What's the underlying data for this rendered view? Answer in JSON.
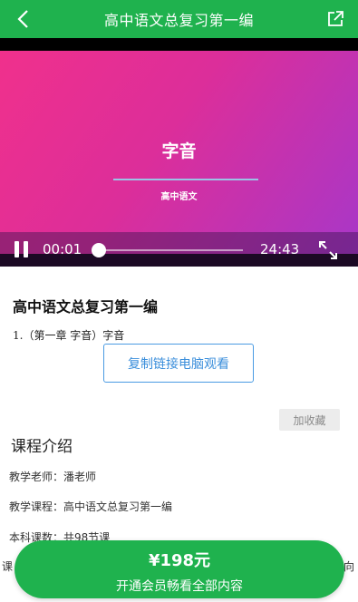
{
  "header": {
    "title": "高中语文总复习第一编",
    "back_icon": "chevron-left-icon",
    "share_icon": "share-external-icon",
    "bg_color": "#1fb24e"
  },
  "video": {
    "slide_title": "字音",
    "slide_subtitle": "高中语文",
    "current_time": "00:01",
    "total_time": "24:43",
    "progress": 0.0007,
    "gradient_colors": [
      "#f0308c",
      "#a837c8"
    ]
  },
  "course": {
    "title": "高中语文总复习第一编",
    "lesson": "1.（第一章 字音）字音",
    "copy_button": "复制链接电脑观看",
    "favorite_button": "加收藏"
  },
  "intro": {
    "title": "课程介绍",
    "teacher": "教学老师：潘老师",
    "course_name": "教学课程：高中语文总复习第一编",
    "lesson_count": "本科课数：共98节课",
    "frag_left": "课",
    "frag_right": "向"
  },
  "purchase": {
    "price": "¥198元",
    "vip_text": "开通会员畅看全部内容"
  }
}
